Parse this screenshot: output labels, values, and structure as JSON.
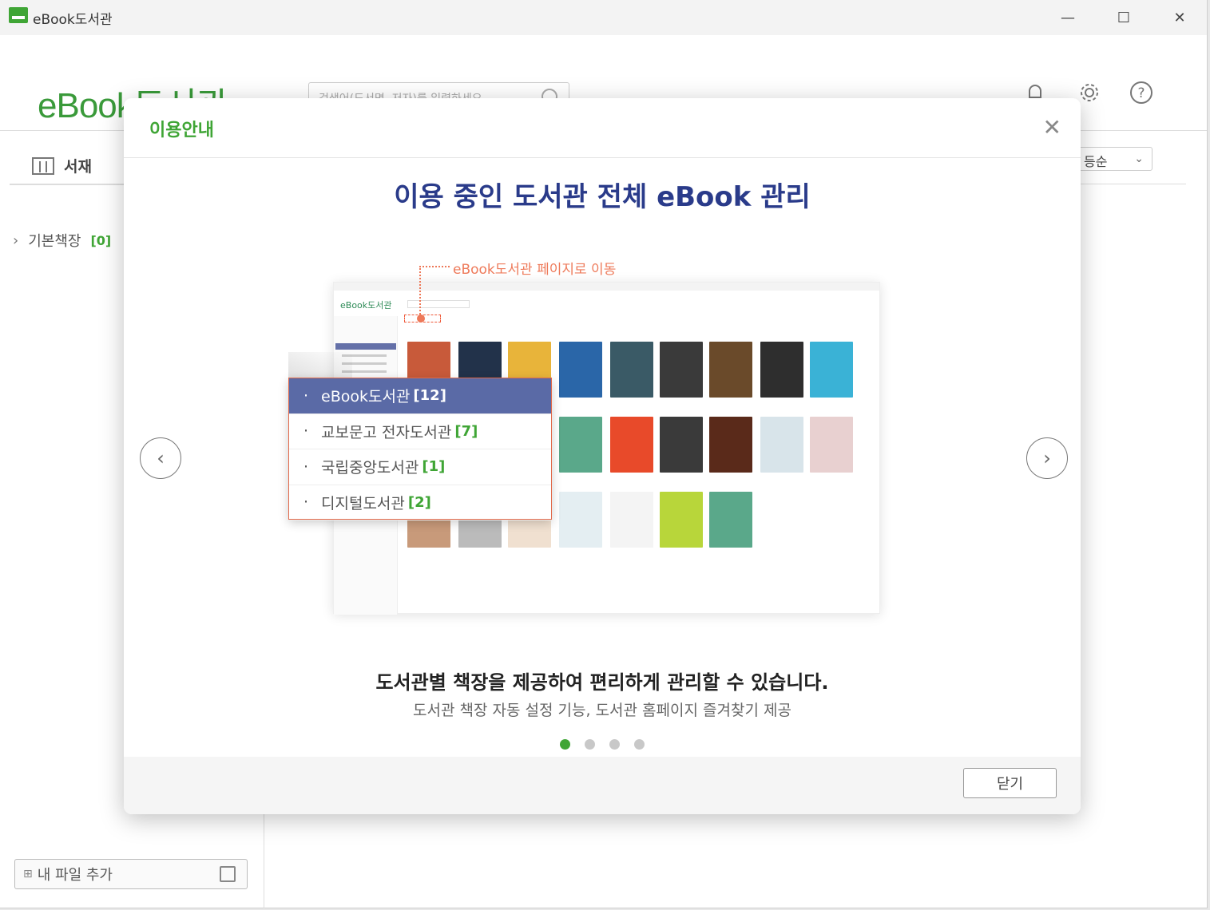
{
  "window": {
    "title": "eBook도서관",
    "minimize": "—",
    "maximize": "☐",
    "close": "✕"
  },
  "header": {
    "logo": "eBook도서관",
    "search_placeholder": "검색어(도서명, 저자)를 입력하세요",
    "icons": [
      "bell-icon",
      "gear-icon",
      "help-icon"
    ]
  },
  "sidebar": {
    "tab_label": "서재",
    "shelf_label": "기본책장",
    "shelf_count": "[0]",
    "add_file_label": "내 파일 추가"
  },
  "main": {
    "sort_value": "등순"
  },
  "modal": {
    "title": "이용안내",
    "close_icon": "✕",
    "slide_title": "이용 중인 도서관 전체 eBook 관리",
    "annotation": "eBook도서관 페이지로 이동",
    "libraries": [
      {
        "name": "eBook도서관",
        "count": "[12]"
      },
      {
        "name": "교보문고 전자도서관",
        "count": "[7]"
      },
      {
        "name": "국립중앙도서관",
        "count": "[1]"
      },
      {
        "name": "디지털도서관",
        "count": "[2]"
      }
    ],
    "description": "도서관별 책장을 제공하여 편리하게 관리할 수 있습니다.",
    "sub_description": "도서관 책장 자동 설정 기능, 도서관 홈페이지 즐겨찾기 제공",
    "current_slide": 1,
    "total_slides": 4,
    "close_button": "닫기",
    "prev_icon": "‹",
    "next_icon": "›"
  },
  "colors": {
    "accent": "#3fa535",
    "title_blue": "#2a3b8a",
    "annotation": "#ee7a5a",
    "selected": "#5a6aa6"
  }
}
